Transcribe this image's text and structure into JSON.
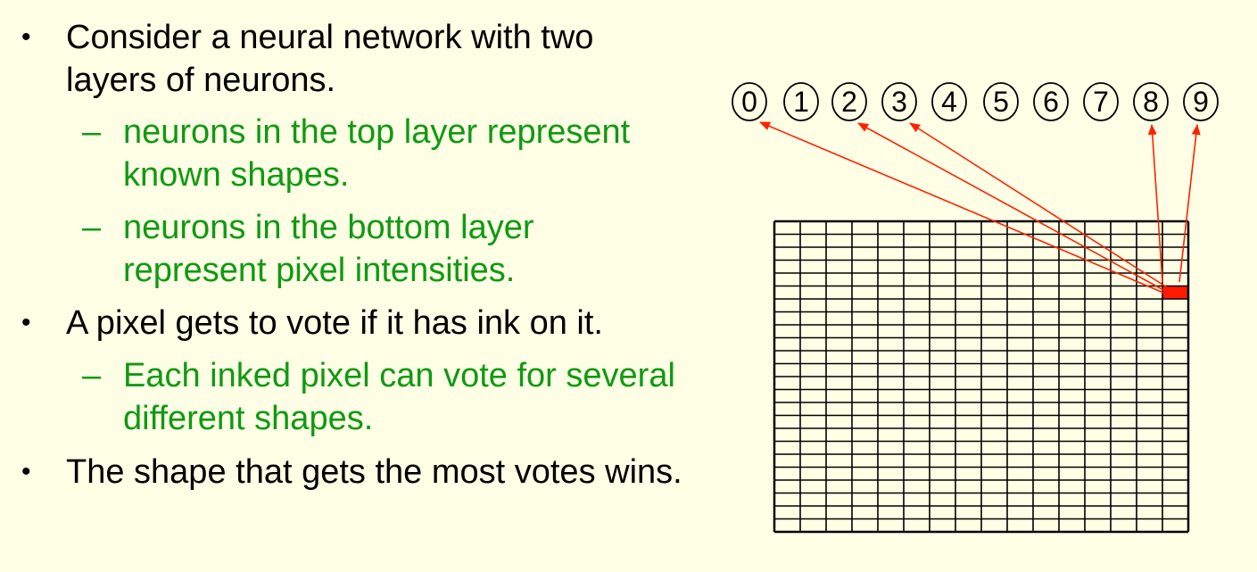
{
  "bullets": {
    "b1_line1": "Consider a neural network with two",
    "b1_line2": "layers of neurons.",
    "s1_line1": "neurons in the top layer represent",
    "s1_line2": "known shapes.",
    "s2_line1": " neurons in the bottom layer",
    "s2_line2": "represent pixel intensities.",
    "b2": "A pixel gets to vote if it has ink on it.",
    "s3_line1": "Each inked pixel can vote for several",
    "s3_line2": "different shapes.",
    "b3": "The shape that gets the most votes wins."
  },
  "markers": {
    "bullet": "•",
    "dash": "–"
  },
  "digits": [
    "0",
    "1",
    "2",
    "3",
    "4",
    "5",
    "6",
    "7",
    "8",
    "9"
  ],
  "grid": {
    "rows": 24,
    "cols": 16,
    "inked_cell": {
      "row": 5,
      "col": 15
    }
  },
  "connections": [
    0,
    2,
    3,
    8,
    9
  ],
  "colors": {
    "background": "#ffffe6",
    "text": "#000000",
    "sub_text": "#0f9a12",
    "ink": "#ff1a00",
    "arrow": "#ff2200"
  }
}
